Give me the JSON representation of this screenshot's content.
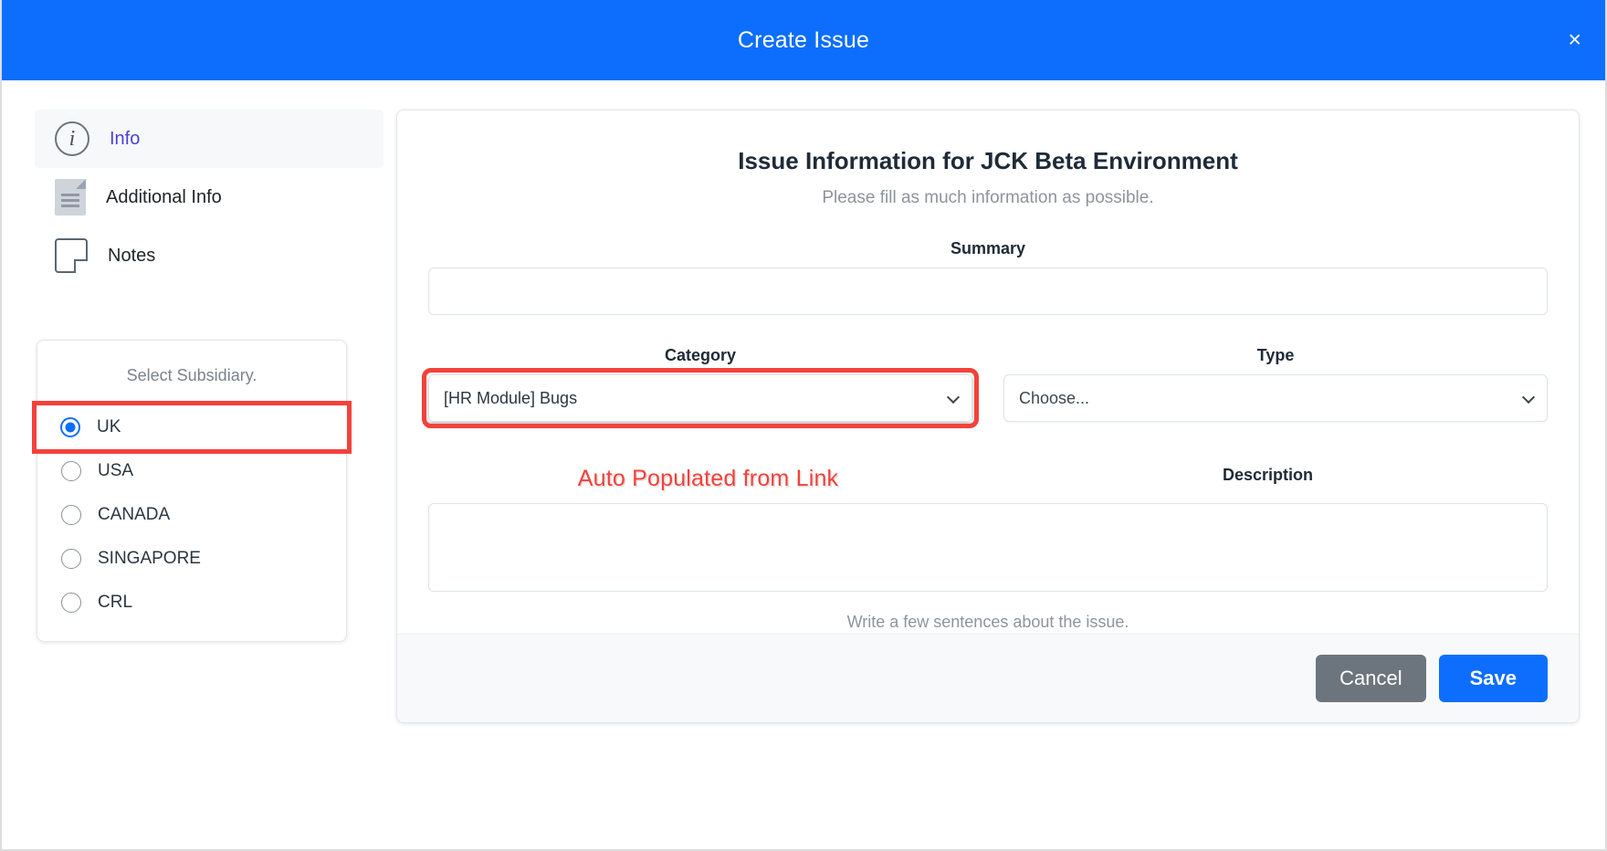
{
  "window": {
    "title": "Create Issue",
    "close_label": "×"
  },
  "sidebar": {
    "items": [
      {
        "label": "Info",
        "icon": "info-circle-icon",
        "active": true
      },
      {
        "label": "Additional Info",
        "icon": "document-icon",
        "active": false
      },
      {
        "label": "Notes",
        "icon": "note-icon",
        "active": false
      }
    ],
    "subsidiary": {
      "title": "Select Subsidiary.",
      "options": [
        {
          "label": "UK",
          "selected": true,
          "highlighted": true
        },
        {
          "label": "USA",
          "selected": false,
          "highlighted": false
        },
        {
          "label": "CANADA",
          "selected": false,
          "highlighted": false
        },
        {
          "label": "SINGAPORE",
          "selected": false,
          "highlighted": false
        },
        {
          "label": "CRL",
          "selected": false,
          "highlighted": false
        }
      ]
    }
  },
  "form": {
    "title": "Issue Information for JCK Beta Environment",
    "subtitle": "Please fill as much information as possible.",
    "summary": {
      "label": "Summary",
      "value": "",
      "placeholder": ""
    },
    "category": {
      "label": "Category",
      "value": "[HR Module] Bugs",
      "highlighted": true
    },
    "type": {
      "label": "Type",
      "value": "Choose...",
      "highlighted": false
    },
    "annotation": "Auto Populated from Link",
    "description": {
      "label": "Description",
      "value": "",
      "placeholder": "",
      "help": "Write a few sentences about the issue."
    },
    "buttons": {
      "cancel": "Cancel",
      "save": "Save"
    }
  },
  "colors": {
    "header_blue": "#0d6efd",
    "accent_red": "#f4413a",
    "active_nav": "#4c3fd8",
    "cancel_gray": "#6c757d"
  }
}
